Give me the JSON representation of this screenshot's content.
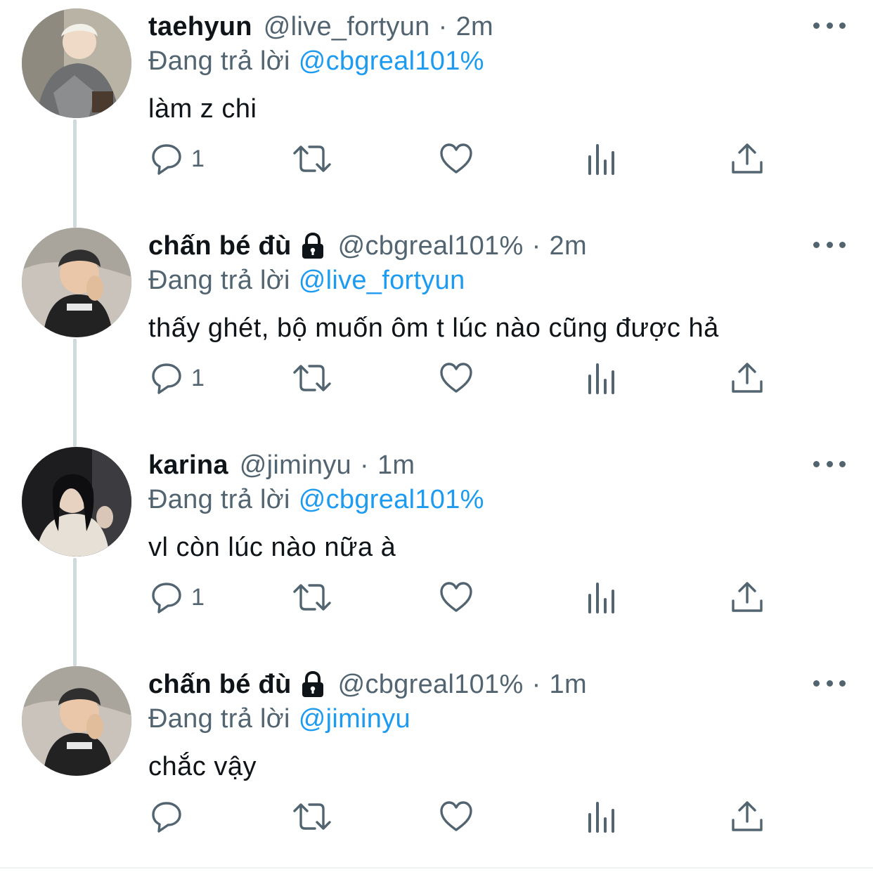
{
  "colors": {
    "name": "#0f1419",
    "secondary": "#536471",
    "link": "#1d9bf0",
    "thread_line": "#cfd9de"
  },
  "tweets": [
    {
      "name": "taehyun",
      "protected": false,
      "handle": "@live_fortyun",
      "separator": "·",
      "time": "2m",
      "reply_prefix": "Đang trả lời",
      "reply_to": "@cbgreal101%",
      "text": "làm z chi",
      "reply_count": "1",
      "avatar_icon": "avatar-photo"
    },
    {
      "name": "chấn bé đù",
      "protected": true,
      "handle": "@cbgreal101%",
      "separator": "·",
      "time": "2m",
      "reply_prefix": "Đang trả lời",
      "reply_to": "@live_fortyun",
      "text": "thấy ghét, bộ muốn ôm t lúc nào cũng được hả",
      "reply_count": "1",
      "avatar_icon": "avatar-photo"
    },
    {
      "name": "karina",
      "protected": false,
      "handle": "@jiminyu",
      "separator": "·",
      "time": "1m",
      "reply_prefix": "Đang trả lời",
      "reply_to": "@cbgreal101%",
      "text": "vl còn lúc nào nữa à",
      "reply_count": "1",
      "avatar_icon": "avatar-photo"
    },
    {
      "name": "chấn bé đù",
      "protected": true,
      "handle": "@cbgreal101%",
      "separator": "·",
      "time": "1m",
      "reply_prefix": "Đang trả lời",
      "reply_to": "@jiminyu",
      "text": "chắc vậy",
      "reply_count": "",
      "avatar_icon": "avatar-photo"
    }
  ],
  "actions": [
    "reply-icon",
    "retweet-icon",
    "like-icon",
    "analytics-icon",
    "share-icon"
  ]
}
